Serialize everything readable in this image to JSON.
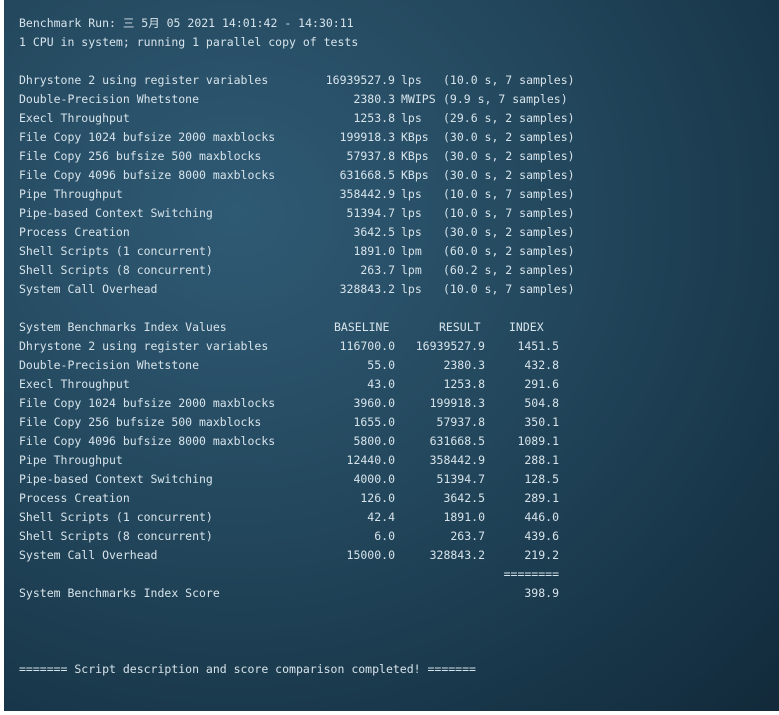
{
  "header": {
    "top_rule": "------------------------------------------------------------------------",
    "run_line": "Benchmark Run: 三 5月 05 2021 14:01:42 - 14:30:11",
    "cpu_line": "1 CPU in system; running 1 parallel copy of tests"
  },
  "raw_results": [
    {
      "name": "Dhrystone 2 using register variables",
      "value": "16939527.9",
      "unit": "lps",
      "info": "(10.0 s, 7 samples)"
    },
    {
      "name": "Double-Precision Whetstone",
      "value": "2380.3",
      "unit": "MWIPS",
      "info": "(9.9 s, 7 samples)"
    },
    {
      "name": "Execl Throughput",
      "value": "1253.8",
      "unit": "lps",
      "info": "(29.6 s, 2 samples)"
    },
    {
      "name": "File Copy 1024 bufsize 2000 maxblocks",
      "value": "199918.3",
      "unit": "KBps",
      "info": "(30.0 s, 2 samples)"
    },
    {
      "name": "File Copy 256 bufsize 500 maxblocks",
      "value": "57937.8",
      "unit": "KBps",
      "info": "(30.0 s, 2 samples)"
    },
    {
      "name": "File Copy 4096 bufsize 8000 maxblocks",
      "value": "631668.5",
      "unit": "KBps",
      "info": "(30.0 s, 2 samples)"
    },
    {
      "name": "Pipe Throughput",
      "value": "358442.9",
      "unit": "lps",
      "info": "(10.0 s, 7 samples)"
    },
    {
      "name": "Pipe-based Context Switching",
      "value": "51394.7",
      "unit": "lps",
      "info": "(10.0 s, 7 samples)"
    },
    {
      "name": "Process Creation",
      "value": "3642.5",
      "unit": "lps",
      "info": "(30.0 s, 2 samples)"
    },
    {
      "name": "Shell Scripts (1 concurrent)",
      "value": "1891.0",
      "unit": "lpm",
      "info": "(60.0 s, 2 samples)"
    },
    {
      "name": "Shell Scripts (8 concurrent)",
      "value": "263.7",
      "unit": "lpm",
      "info": "(60.2 s, 2 samples)"
    },
    {
      "name": "System Call Overhead",
      "value": "328843.2",
      "unit": "lps",
      "info": "(10.0 s, 7 samples)"
    }
  ],
  "index_table": {
    "title": "System Benchmarks Index Values",
    "col_baseline": "BASELINE",
    "col_result": "RESULT",
    "col_index": "INDEX",
    "rows": [
      {
        "name": "Dhrystone 2 using register variables",
        "baseline": "116700.0",
        "result": "16939527.9",
        "index": "1451.5"
      },
      {
        "name": "Double-Precision Whetstone",
        "baseline": "55.0",
        "result": "2380.3",
        "index": "432.8"
      },
      {
        "name": "Execl Throughput",
        "baseline": "43.0",
        "result": "1253.8",
        "index": "291.6"
      },
      {
        "name": "File Copy 1024 bufsize 2000 maxblocks",
        "baseline": "3960.0",
        "result": "199918.3",
        "index": "504.8"
      },
      {
        "name": "File Copy 256 bufsize 500 maxblocks",
        "baseline": "1655.0",
        "result": "57937.8",
        "index": "350.1"
      },
      {
        "name": "File Copy 4096 bufsize 8000 maxblocks",
        "baseline": "5800.0",
        "result": "631668.5",
        "index": "1089.1"
      },
      {
        "name": "Pipe Throughput",
        "baseline": "12440.0",
        "result": "358442.9",
        "index": "288.1"
      },
      {
        "name": "Pipe-based Context Switching",
        "baseline": "4000.0",
        "result": "51394.7",
        "index": "128.5"
      },
      {
        "name": "Process Creation",
        "baseline": "126.0",
        "result": "3642.5",
        "index": "289.1"
      },
      {
        "name": "Shell Scripts (1 concurrent)",
        "baseline": "42.4",
        "result": "1891.0",
        "index": "446.0"
      },
      {
        "name": "Shell Scripts (8 concurrent)",
        "baseline": "6.0",
        "result": "263.7",
        "index": "439.6"
      },
      {
        "name": "System Call Overhead",
        "baseline": "15000.0",
        "result": "328843.2",
        "index": "219.2"
      }
    ],
    "separator": "========",
    "score_label": "System Benchmarks Index Score",
    "score_value": "398.9"
  },
  "footer": {
    "message": "======= Script description and score comparison completed! ======="
  }
}
